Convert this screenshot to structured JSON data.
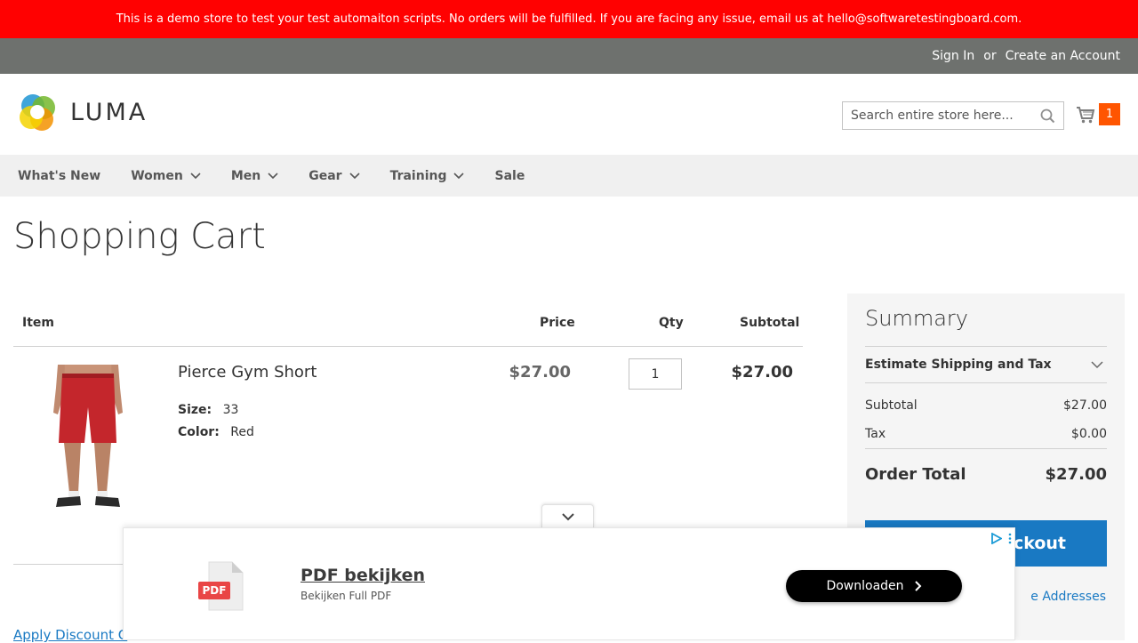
{
  "demo_notice": "This is a demo store to test your test automaiton scripts. No orders will be fulfilled. If you are facing any issue, email us at hello@softwaretestingboard.com.",
  "header": {
    "sign_in": "Sign In",
    "or": "or",
    "create_account": "Create an Account"
  },
  "logo": {
    "text": "LUMA"
  },
  "search": {
    "placeholder": "Search entire store here..."
  },
  "minicart": {
    "count": "1"
  },
  "nav": {
    "whats_new": "What's New",
    "women": "Women",
    "men": "Men",
    "gear": "Gear",
    "training": "Training",
    "sale": "Sale"
  },
  "page_title": "Shopping Cart",
  "cart": {
    "headers": {
      "item": "Item",
      "price": "Price",
      "qty": "Qty",
      "subtotal": "Subtotal"
    },
    "item": {
      "name": "Pierce Gym Short",
      "size_label": "Size:",
      "size_value": "33",
      "color_label": "Color:",
      "color_value": "Red",
      "price": "$27.00",
      "qty": "1",
      "subtotal": "$27.00"
    },
    "discount_link": "Apply Discount C"
  },
  "summary": {
    "title": "Summary",
    "estimate": "Estimate Shipping and Tax",
    "subtotal_label": "Subtotal",
    "subtotal_value": "$27.00",
    "tax_label": "Tax",
    "tax_value": "$0.00",
    "total_label": "Order Total",
    "total_value": "$27.00",
    "checkout": "eckout",
    "multi_address": "e Addresses"
  },
  "ad": {
    "pdf_badge": "PDF",
    "title": "PDF bekijken",
    "subtitle": "Bekijken Full PDF",
    "button": "Downloaden"
  },
  "colors": {
    "demo_bar": "#ff0101",
    "header_bar": "#6e716e",
    "accent": "#1979c3",
    "cart_badge": "#ff5501"
  }
}
